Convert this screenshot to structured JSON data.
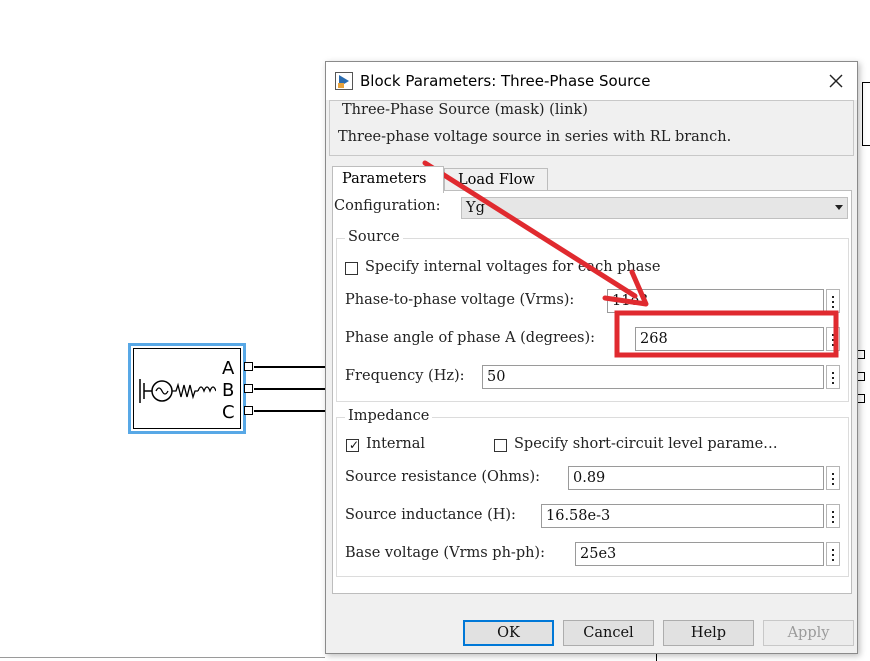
{
  "dialog": {
    "title": "Block Parameters: Three-Phase Source",
    "mask_title": "Three-Phase Source (mask) (link)",
    "mask_description": "Three-phase voltage source in series with RL branch.",
    "tabs": [
      {
        "label": "Parameters",
        "active": true
      },
      {
        "label": "Load Flow",
        "active": false
      }
    ],
    "configuration": {
      "label": "Configuration:",
      "value": "Yg"
    },
    "source_group": {
      "title": "Source",
      "specify_internal_label": "Specify internal voltages for each phase",
      "phase_voltage": {
        "label": "Phase-to-phase voltage (Vrms):",
        "value": "11e3"
      },
      "phase_angle": {
        "label": "Phase angle of phase A (degrees):",
        "value": "268"
      },
      "frequency": {
        "label": "Frequency (Hz):",
        "value": "50"
      }
    },
    "impedance_group": {
      "title": "Impedance",
      "internal_label": "Internal",
      "internal_checked": true,
      "short_circuit_label": "Specify short-circuit level parame…",
      "resistance": {
        "label": "Source resistance (Ohms):",
        "value": "0.89"
      },
      "inductance": {
        "label": "Source inductance (H):",
        "value": "16.58e-3"
      },
      "base_voltage": {
        "label": "Base voltage (Vrms ph-ph):",
        "value": "25e3"
      }
    },
    "buttons": {
      "ok": "OK",
      "cancel": "Cancel",
      "help": "Help",
      "apply": "Apply"
    }
  },
  "canvas": {
    "ports": [
      "A",
      "B",
      "C"
    ]
  },
  "annotation": {
    "color": "#e02a2f"
  }
}
